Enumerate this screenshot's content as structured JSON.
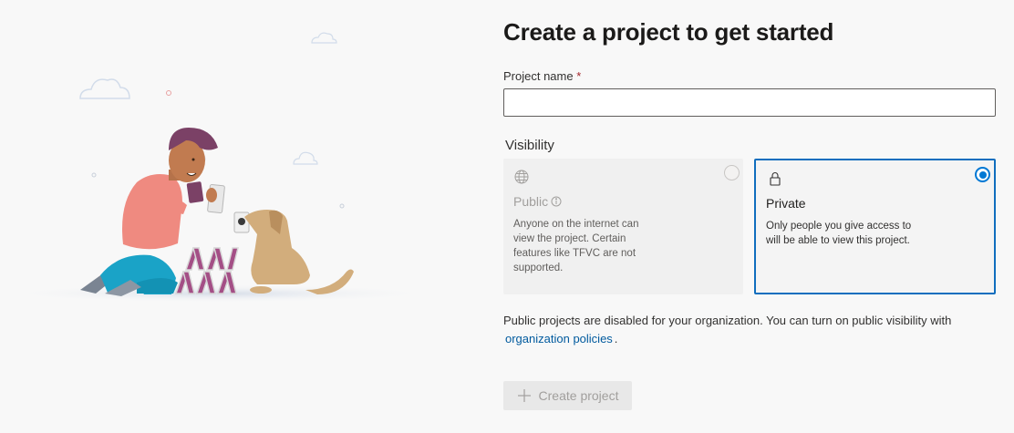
{
  "page": {
    "title": "Create a project to get started"
  },
  "form": {
    "project_name_label": "Project name",
    "required_marker": "*",
    "project_name_value": "",
    "visibility_label": "Visibility"
  },
  "visibility_options": [
    {
      "title": "Public",
      "description": "Anyone on the internet can view the project. Certain features like TFVC are not supported.",
      "icon": "globe-icon",
      "selected": false,
      "disabled": true
    },
    {
      "title": "Private",
      "description": "Only people you give access to will be able to view this project.",
      "icon": "lock-icon",
      "selected": true,
      "disabled": false
    }
  ],
  "notice": {
    "text": "Public projects are disabled for your organization. You can turn on public visibility with",
    "link_text": "organization policies",
    "suffix": "."
  },
  "actions": {
    "create_label": "Create project",
    "create_icon": "plus-icon",
    "create_disabled": true
  },
  "colors": {
    "accent": "#0078d4",
    "link": "#005a9e",
    "required": "#a4262c"
  }
}
